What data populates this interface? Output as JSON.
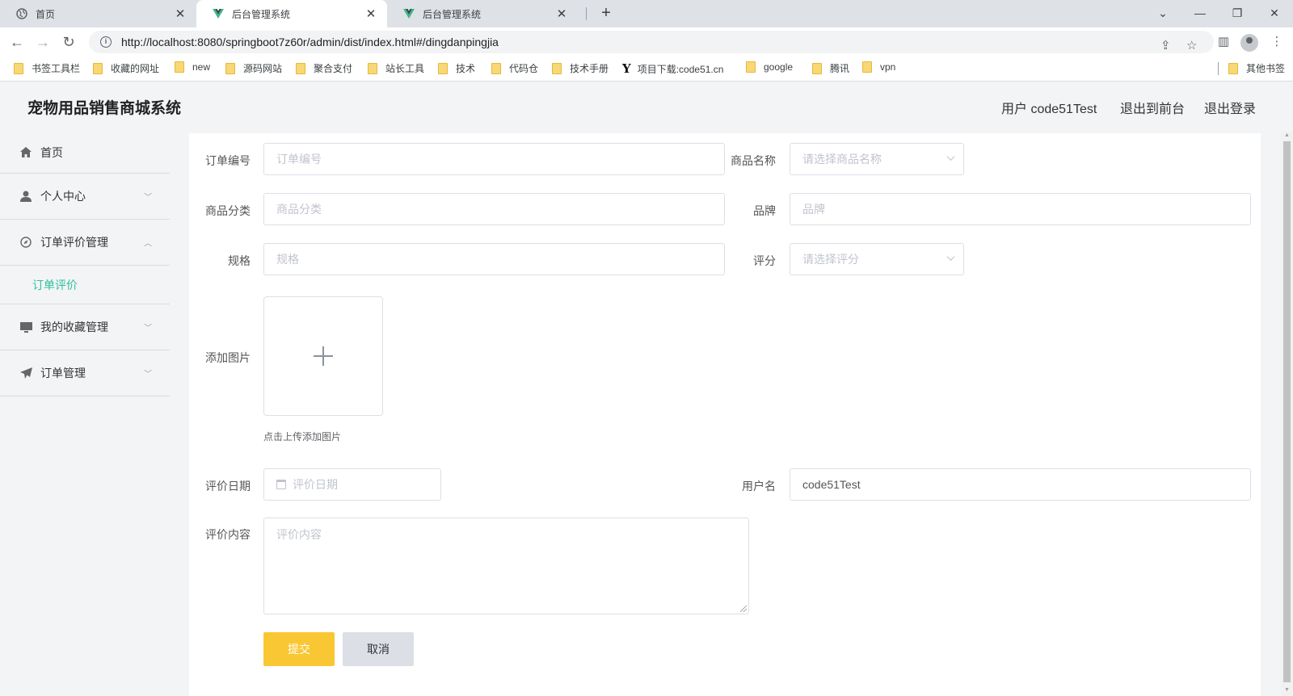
{
  "browser": {
    "tabs": [
      {
        "title": "首页",
        "icon": "globe-icon"
      },
      {
        "title": "后台管理系统",
        "icon": "vue-logo-icon"
      },
      {
        "title": "后台管理系统",
        "icon": "vue-logo-icon"
      }
    ],
    "url": "http://localhost:8080/springboot7z60r/admin/dist/index.html#/dingdanpingjia",
    "bookmarks": [
      "书签工具栏",
      "收藏的网址",
      "new",
      "源码网站",
      "聚合支付",
      "站长工具",
      "技术",
      "代码仓",
      "技术手册",
      "项目下载:code51.cn",
      "google",
      "腾讯",
      "vpn"
    ],
    "other_bookmarks": "其他书签"
  },
  "header": {
    "title": "宠物用品销售商城系统",
    "user_label": "用户 code51Test",
    "to_front": "退出到前台",
    "logout": "退出登录"
  },
  "sidebar": {
    "items": [
      {
        "label": "首页",
        "icon": "home-icon"
      },
      {
        "label": "个人中心",
        "icon": "user-icon"
      },
      {
        "label": "订单评价管理",
        "icon": "compass-icon",
        "expanded": true,
        "sub": "订单评价"
      },
      {
        "label": "我的收藏管理",
        "icon": "monitor-icon"
      },
      {
        "label": "订单管理",
        "icon": "send-icon"
      }
    ]
  },
  "form": {
    "order_no": {
      "label": "订单编号",
      "placeholder": "订单编号"
    },
    "product_name": {
      "label": "商品名称",
      "placeholder": "请选择商品名称"
    },
    "category": {
      "label": "商品分类",
      "placeholder": "商品分类"
    },
    "brand": {
      "label": "品牌",
      "placeholder": "品牌"
    },
    "spec": {
      "label": "规格",
      "placeholder": "规格"
    },
    "rating": {
      "label": "评分",
      "placeholder": "请选择评分"
    },
    "image": {
      "label": "添加图片",
      "hint": "点击上传添加图片"
    },
    "review_date": {
      "label": "评价日期",
      "placeholder": "评价日期"
    },
    "username": {
      "label": "用户名",
      "value": "code51Test"
    },
    "content": {
      "label": "评价内容",
      "placeholder": "评价内容"
    },
    "submit": "提交",
    "cancel": "取消"
  },
  "colors": {
    "accent": "#2fbfa0",
    "submit": "#f9c733",
    "cancel": "#dcdfe6"
  }
}
